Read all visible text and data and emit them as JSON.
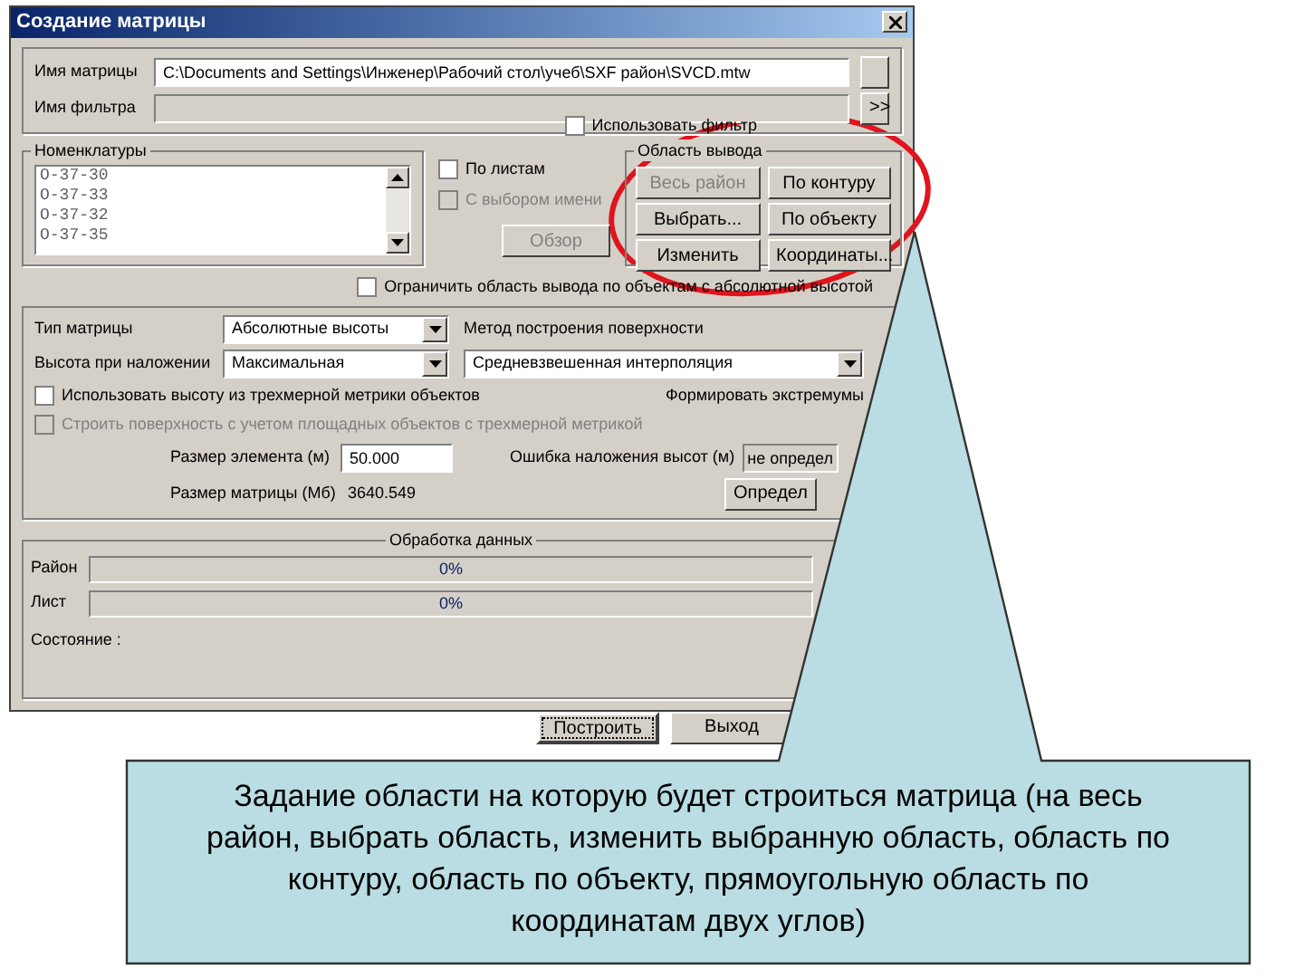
{
  "dialog": {
    "title": "Создание матрицы",
    "fields": [
      {
        "label": "Имя матрицы",
        "value": "C:\\Documents and Settings\\Инженер\\Рабочий стол\\учеб\\SXF район\\SVCD.mtw"
      },
      {
        "label": "Имя фильтра",
        "button": ">>"
      }
    ],
    "use_filter": {
      "label": "Использовать фильтр",
      "checked": false
    },
    "sheets": {
      "title": "Номенклатуры",
      "items": [
        "O-37-30",
        "O-37-33",
        "O-37-32",
        "O-37-35"
      ]
    },
    "sheet_options": [
      {
        "label": "По листам",
        "checked": false,
        "disabled": false
      },
      {
        "label": "С выбором имени",
        "checked": false,
        "disabled": true
      }
    ],
    "browse": {
      "label": "Обзор",
      "disabled": true
    },
    "output_area": {
      "title": "Область вывода",
      "buttons": [
        {
          "label": "Весь район",
          "disabled": true
        },
        {
          "label": "По контуру",
          "disabled": false
        },
        {
          "label": "Выбрать...",
          "disabled": false
        },
        {
          "label": "По объекту",
          "disabled": false
        },
        {
          "label": "Изменить",
          "disabled": false
        },
        {
          "label": "Координаты...",
          "disabled": false
        }
      ]
    },
    "limit": {
      "label": "Ограничить область вывода по объектам с абсолютной высотой",
      "checked": false
    },
    "matrix_type": {
      "label": "Тип матрицы",
      "value": "Абсолютные высоты"
    },
    "method": {
      "label": "Метод построения поверхности",
      "value": "Средневзвешенная интерполяция"
    },
    "overlay_height": {
      "label": "Высота при наложении",
      "value": "Максимальная"
    },
    "options": [
      {
        "label": "Использовать высоту из трехмерной метрики объектов",
        "checked": false,
        "disabled": false
      },
      {
        "label": "Строить поверхность с учетом площадных объектов с трехмерной метрикой",
        "checked": false,
        "disabled": true
      }
    ],
    "extremes": "Формировать экстремумы",
    "element_size": {
      "label": "Размер элемента (м)",
      "value": "50.000"
    },
    "matrix_size": {
      "label": "Размер матрицы (Мб)",
      "value": "3640.549"
    },
    "height_error": {
      "label": "Ошибка наложения высот (м)",
      "value": "не определ"
    },
    "define_button": "Определ",
    "processing": {
      "title": "Обработка данных",
      "bars": [
        {
          "label": "Район",
          "level": 0,
          "reading": "0%"
        },
        {
          "label": "Лист",
          "level": 0,
          "reading": "0%"
        }
      ],
      "state_label": "Состояние :"
    },
    "buttons": [
      {
        "label": "Построить",
        "focused": true
      },
      {
        "label": "Выход",
        "focused": false
      }
    ]
  },
  "callout": {
    "text": "Задание области на которую будет строиться матрица (на  весь район, выбрать область, изменить выбранную область, область по контуру, область по объекту, прямоугольную область по координатам двух углов)"
  }
}
